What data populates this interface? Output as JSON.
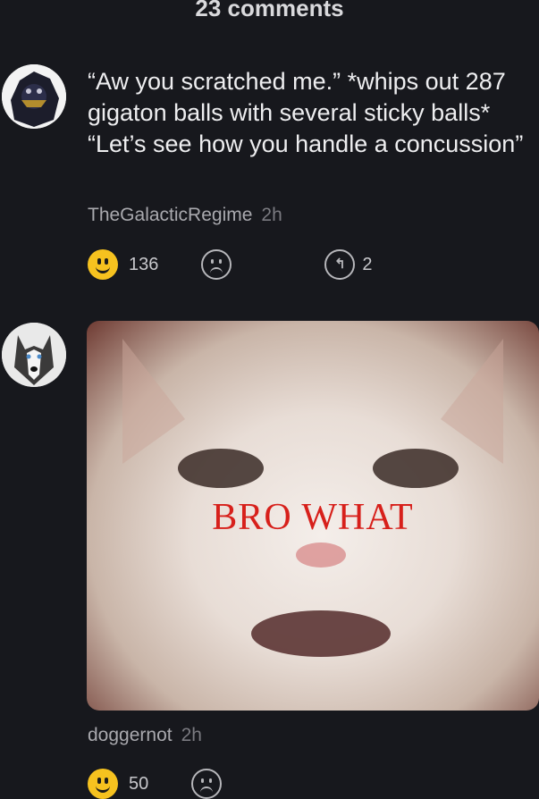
{
  "header": {
    "comments_count": "23 comments"
  },
  "comments": [
    {
      "text": "“Aw you scratched me.” *whips out 287 gigaton balls with several sticky balls* “Let’s see how you handle a concussion”",
      "author": "TheGalacticRegime",
      "time": "2h",
      "likes": "136",
      "replies": "2"
    },
    {
      "meme_caption": "BRO WHAT",
      "author": "doggernot",
      "time": "2h",
      "likes": "50"
    }
  ],
  "icons": {
    "like": "smile-icon",
    "dislike": "frown-icon",
    "reply": "reply-icon",
    "like_color": "#f6c21f"
  }
}
